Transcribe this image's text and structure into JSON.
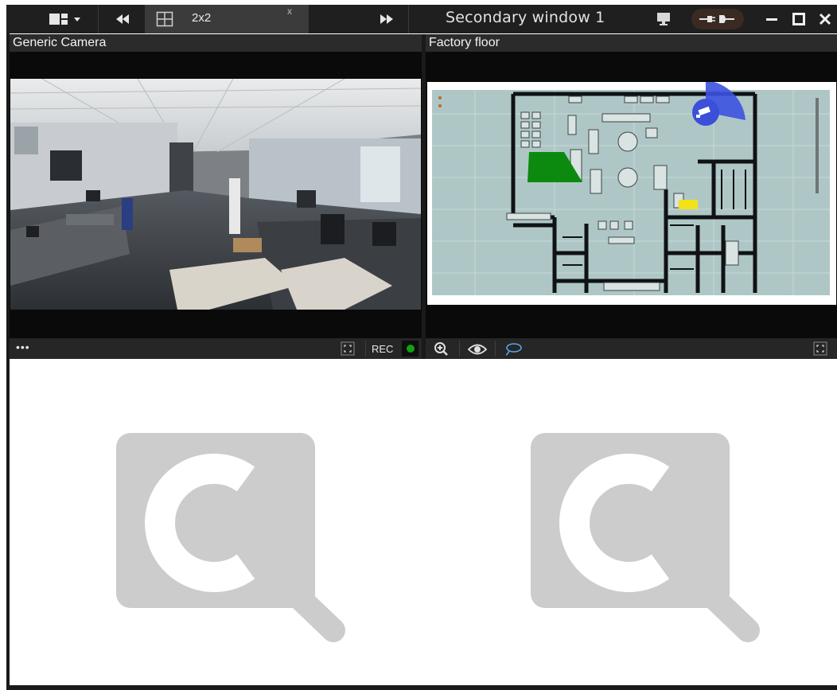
{
  "titlebar": {
    "tab_label": "2x2",
    "tab_close": "x",
    "window_title": "Secondary window 1"
  },
  "tiles": [
    {
      "title": "Generic Camera",
      "rec_label": "REC",
      "more_label": "•••"
    },
    {
      "title": "Factory floor"
    }
  ],
  "colors": {
    "titlebar_bg": "#1f1f1f",
    "rec_indicator": "#14a014",
    "map_area_green": "#0c8a10",
    "map_area_blue": "#3c52e0",
    "map_marker_yellow": "#f2e21a",
    "placeholder_gray": "#cccccc"
  }
}
